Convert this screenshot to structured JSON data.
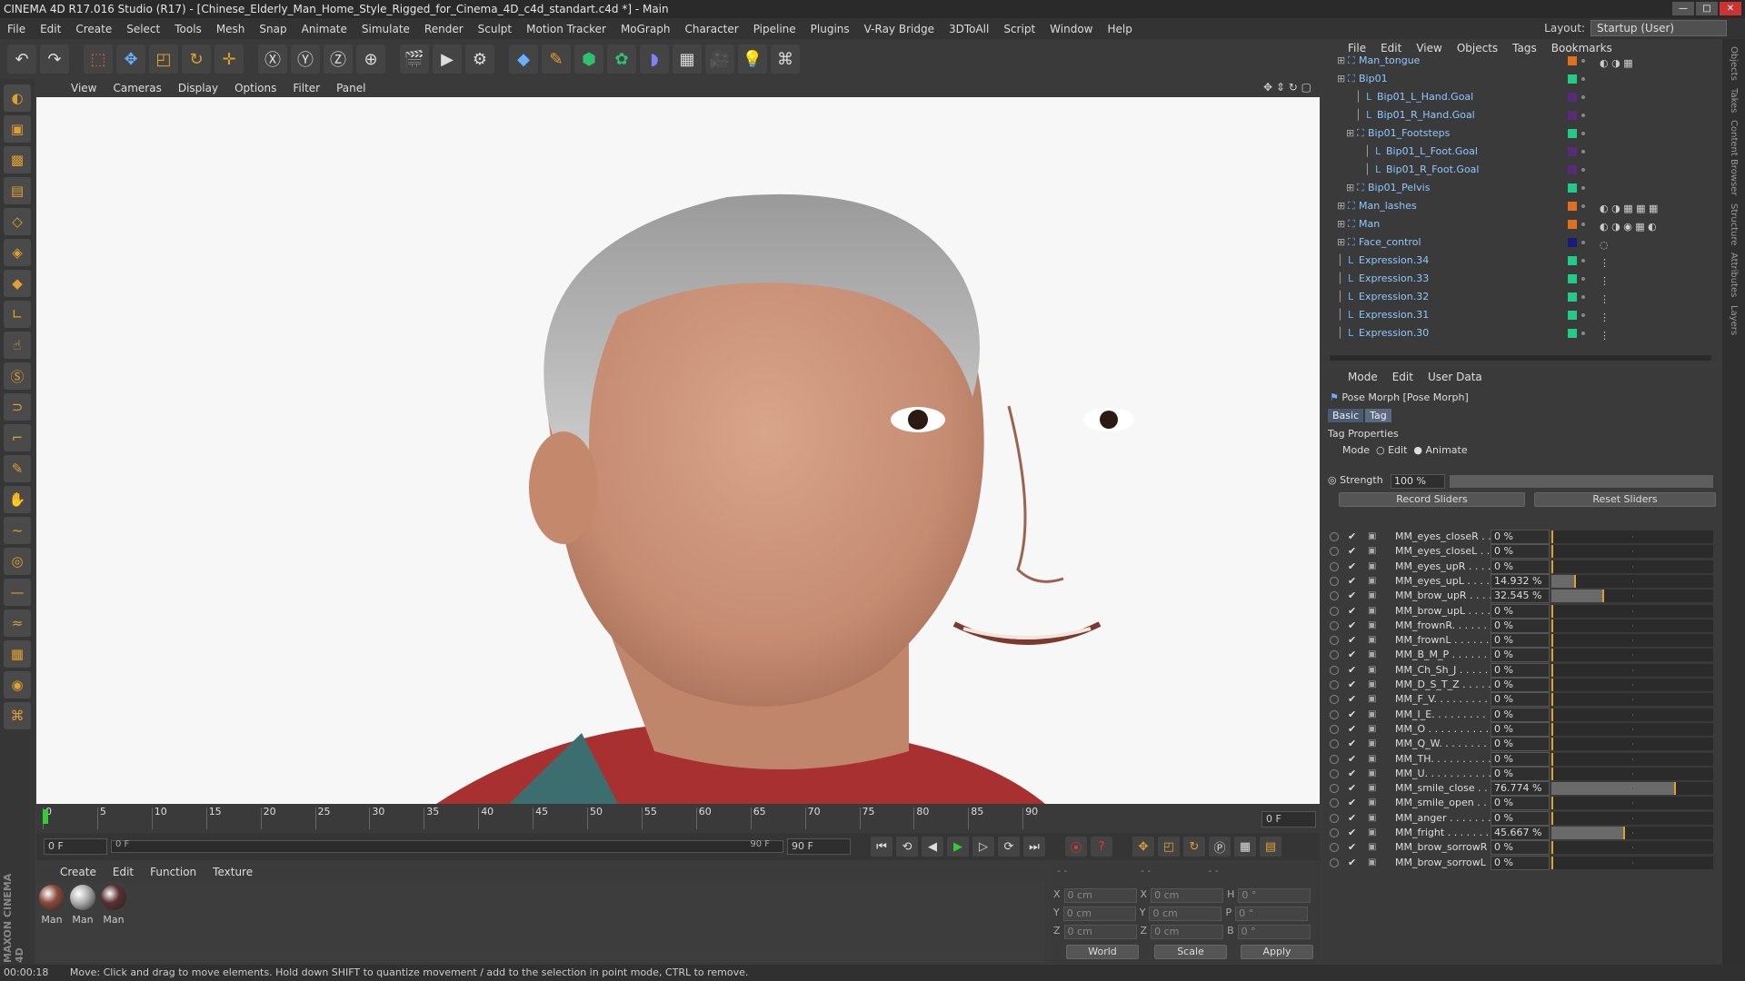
{
  "window": {
    "title": "CINEMA 4D R17.016 Studio (R17) - [Chinese_Elderly_Man_Home_Style_Rigged_for_Cinema_4D_c4d_standart.c4d *] - Main"
  },
  "menu": [
    "File",
    "Edit",
    "Create",
    "Select",
    "Tools",
    "Mesh",
    "Snap",
    "Animate",
    "Simulate",
    "Render",
    "Sculpt",
    "Motion Tracker",
    "MoGraph",
    "Character",
    "Pipeline",
    "Plugins",
    "V-Ray Bridge",
    "3DToAll",
    "Script",
    "Window",
    "Help"
  ],
  "layout": {
    "label": "Layout:",
    "value": "Startup (User)"
  },
  "viewport_menu": [
    "View",
    "Cameras",
    "Display",
    "Options",
    "Filter",
    "Panel"
  ],
  "timeline": {
    "ticks": [
      "0",
      "5",
      "10",
      "15",
      "20",
      "25",
      "30",
      "35",
      "40",
      "45",
      "50",
      "55",
      "60",
      "65",
      "70",
      "75",
      "80",
      "85",
      "90"
    ],
    "end_field": "0 F"
  },
  "playbar": {
    "current": "0 F",
    "range_start": "0 F",
    "range_end": "90 F",
    "max": "90 F"
  },
  "material_menu": [
    "Create",
    "Edit",
    "Function",
    "Texture"
  ],
  "materials": [
    "Man",
    "Man",
    "Man"
  ],
  "coords": {
    "labels": [
      "X",
      "Y",
      "Z"
    ],
    "pos": [
      "0 cm",
      "0 cm",
      "0 cm"
    ],
    "size": [
      "0 cm",
      "0 cm",
      "0 cm"
    ],
    "rot_labels": [
      "H",
      "P",
      "B"
    ],
    "rot": [
      "0 °",
      "0 °",
      "0 °"
    ],
    "mode1": "World",
    "mode2": "Scale",
    "apply": "Apply"
  },
  "status": {
    "time": "00:00:18",
    "message": "Move: Click and drag to move elements. Hold down SHIFT to quantize movement / add to the selection in point mode, CTRL to remove."
  },
  "object_menu": [
    "File",
    "Edit",
    "View",
    "Objects",
    "Tags",
    "Bookmarks"
  ],
  "objects": [
    {
      "name": "Man_tongue",
      "color": "#e07020",
      "tags": "◐ ◑ ▦"
    },
    {
      "name": "Bip01",
      "color": "#22cc88",
      "tags": ""
    },
    {
      "name": "Bip01_L_Hand.Goal",
      "color": "#5a2a7a",
      "tags": ""
    },
    {
      "name": "Bip01_R_Hand.Goal",
      "color": "#5a2a7a",
      "tags": ""
    },
    {
      "name": "Bip01_Footsteps",
      "color": "#22cc88",
      "tags": ""
    },
    {
      "name": "Bip01_L_Foot.Goal",
      "color": "#5a2a7a",
      "tags": ""
    },
    {
      "name": "Bip01_R_Foot.Goal",
      "color": "#5a2a7a",
      "tags": ""
    },
    {
      "name": "Bip01_Pelvis",
      "color": "#22cc88",
      "tags": ""
    },
    {
      "name": "Man_lashes",
      "color": "#e07020",
      "tags": "◐ ◑ ▦ ▦ ▦"
    },
    {
      "name": "Man",
      "color": "#e07020",
      "tags": "◐ ◑ ◉ ▦ ◐"
    },
    {
      "name": "Face_control",
      "color": "#1a1a7a",
      "tags": "◌"
    },
    {
      "name": "Expression.34",
      "color": "#22cc88",
      "tags": "⋮"
    },
    {
      "name": "Expression.33",
      "color": "#22cc88",
      "tags": "⋮"
    },
    {
      "name": "Expression.32",
      "color": "#22cc88",
      "tags": "⋮"
    },
    {
      "name": "Expression.31",
      "color": "#22cc88",
      "tags": "⋮"
    },
    {
      "name": "Expression.30",
      "color": "#22cc88",
      "tags": "⋮"
    }
  ],
  "attr_menu": [
    "Mode",
    "Edit",
    "User Data"
  ],
  "attr": {
    "title": "Pose Morph [Pose Morph]",
    "tabs": [
      "Basic",
      "Tag"
    ],
    "section": "Tag Properties",
    "mode_label": "Mode",
    "mode_edit": "Edit",
    "mode_animate": "Animate",
    "strength_label": "Strength",
    "strength_value": "100 %",
    "strength_fraction": 1.0,
    "record": "Record Sliders",
    "reset": "Reset Sliders"
  },
  "morphs": [
    {
      "name": "MM_eyes_closeR . .",
      "value": "0 %",
      "fraction": 0
    },
    {
      "name": "MM_eyes_closeL . .",
      "value": "0 %",
      "fraction": 0
    },
    {
      "name": "MM_eyes_upR . . . .",
      "value": "0 %",
      "fraction": 0
    },
    {
      "name": "MM_eyes_upL . . . .",
      "value": "14.932 %",
      "fraction": 0.14932
    },
    {
      "name": "MM_brow_upR . . . .",
      "value": "32.545 %",
      "fraction": 0.32545
    },
    {
      "name": "MM_brow_upL . . . .",
      "value": "0 %",
      "fraction": 0
    },
    {
      "name": "MM_frownR. . . . . .",
      "value": "0 %",
      "fraction": 0
    },
    {
      "name": "MM_frownL . . . . . .",
      "value": "0 %",
      "fraction": 0
    },
    {
      "name": "MM_B_M_P . . . . . .",
      "value": "0 %",
      "fraction": 0
    },
    {
      "name": "MM_Ch_Sh_J . . . . .",
      "value": "0 %",
      "fraction": 0
    },
    {
      "name": "MM_D_S_T_Z . . . . .",
      "value": "0 %",
      "fraction": 0
    },
    {
      "name": "MM_F_V. . . . . . . . .",
      "value": "0 %",
      "fraction": 0
    },
    {
      "name": "MM_I_E. . . . . . . . .",
      "value": "0 %",
      "fraction": 0
    },
    {
      "name": "MM_O . . . . . . . . . .",
      "value": "0 %",
      "fraction": 0
    },
    {
      "name": "MM_Q_W. . . . . . . .",
      "value": "0 %",
      "fraction": 0
    },
    {
      "name": "MM_TH. . . . . . . . . .",
      "value": "0 %",
      "fraction": 0
    },
    {
      "name": "MM_U. . . . . . . . . . .",
      "value": "0 %",
      "fraction": 0
    },
    {
      "name": "MM_smile_close . . .",
      "value": "76.774 %",
      "fraction": 0.76774
    },
    {
      "name": "MM_smile_open . . .",
      "value": "0 %",
      "fraction": 0
    },
    {
      "name": "MM_anger . . . . . . .",
      "value": "0 %",
      "fraction": 0
    },
    {
      "name": "MM_fright . . . . . . .",
      "value": "45.667 %",
      "fraction": 0.45667
    },
    {
      "name": "MM_brow_sorrowR",
      "value": "0 %",
      "fraction": 0
    },
    {
      "name": "MM_brow_sorrowL",
      "value": "0 %",
      "fraction": 0
    }
  ],
  "right_tabs": [
    "Objects",
    "Takes",
    "Content Browser",
    "Structure",
    "Attributes",
    "Layers"
  ]
}
